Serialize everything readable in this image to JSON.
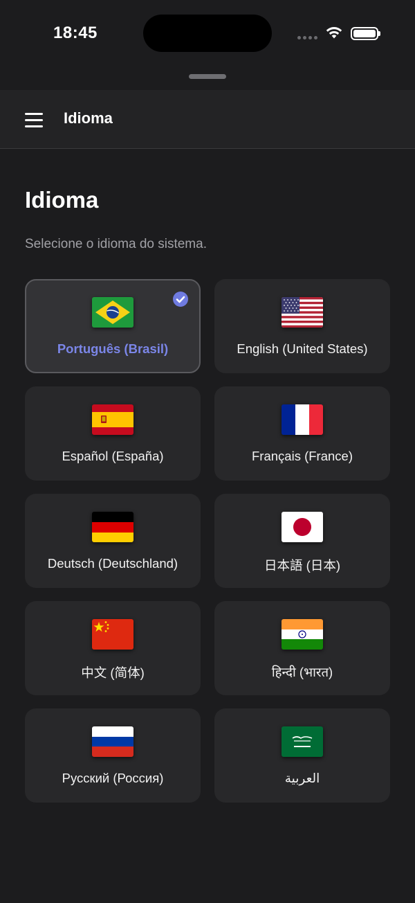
{
  "status_bar": {
    "time": "18:45"
  },
  "header": {
    "title": "Idioma",
    "menu_icon": "hamburger-icon"
  },
  "page": {
    "title": "Idioma",
    "subtitle": "Selecione o idioma do sistema."
  },
  "languages": [
    {
      "label": "Português (Brasil)",
      "flag": "brazil-flag-icon",
      "selected": true
    },
    {
      "label": "English (United States)",
      "flag": "usa-flag-icon",
      "selected": false
    },
    {
      "label": "Español (España)",
      "flag": "spain-flag-icon",
      "selected": false
    },
    {
      "label": "Français (France)",
      "flag": "france-flag-icon",
      "selected": false
    },
    {
      "label": "Deutsch (Deutschland)",
      "flag": "germany-flag-icon",
      "selected": false
    },
    {
      "label": "日本語 (日本)",
      "flag": "japan-flag-icon",
      "selected": false
    },
    {
      "label": "中文 (简体)",
      "flag": "china-flag-icon",
      "selected": false
    },
    {
      "label": "हिन्दी (भारत)",
      "flag": "india-flag-icon",
      "selected": false
    },
    {
      "label": "Русский (Россия)",
      "flag": "russia-flag-icon",
      "selected": false
    },
    {
      "label": "العربية",
      "flag": "saudi-arabia-flag-icon",
      "selected": false
    }
  ],
  "colors": {
    "accent": "#6f7be0",
    "background": "#1c1c1e",
    "card": "#28282a"
  }
}
